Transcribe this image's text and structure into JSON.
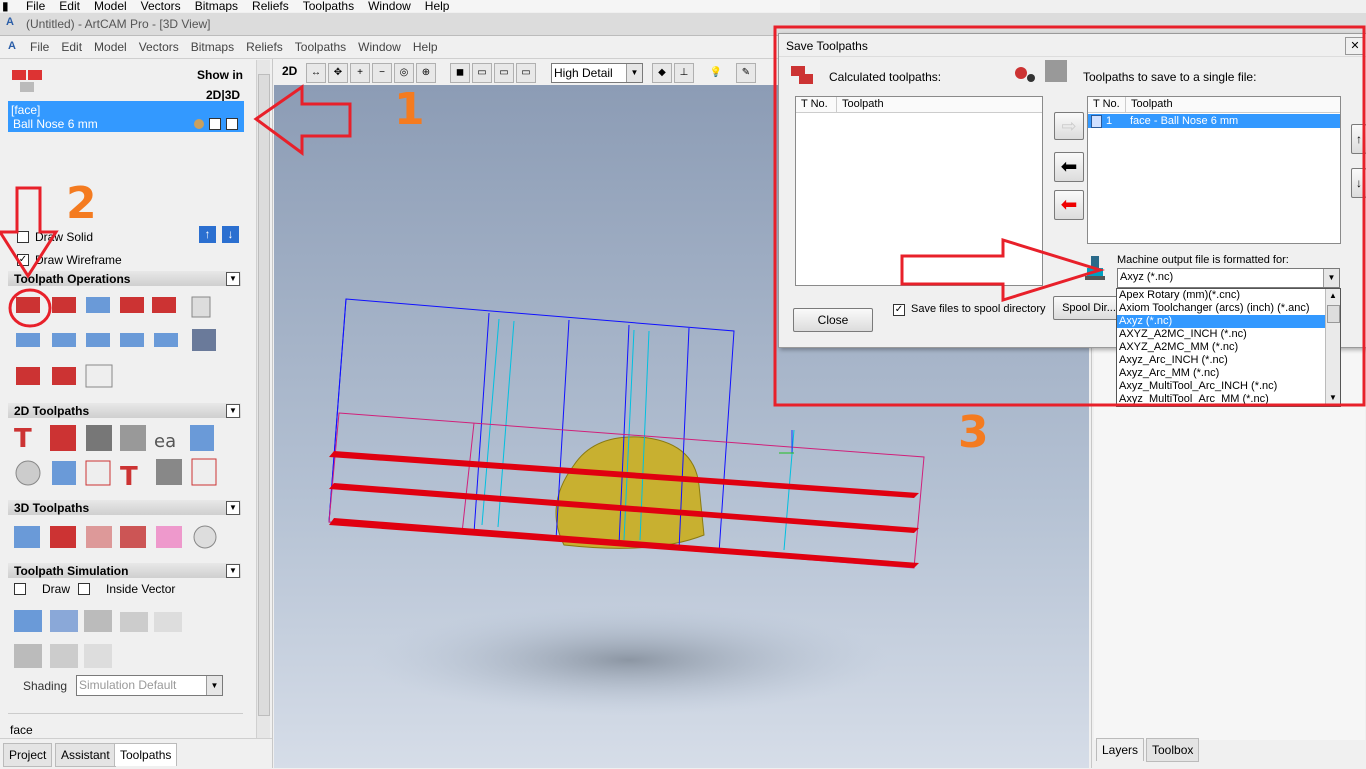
{
  "top_menu": [
    "File",
    "Edit",
    "Model",
    "Vectors",
    "Bitmaps",
    "Reliefs",
    "Toolpaths",
    "Window",
    "Help"
  ],
  "window_title": "(Untitled) - ArtCAM Pro - [3D View]",
  "app_menu": [
    "File",
    "Edit",
    "Model",
    "Vectors",
    "Bitmaps",
    "Reliefs",
    "Toolpaths",
    "Window",
    "Help"
  ],
  "left_panel": {
    "show_in_label": "Show in",
    "show_in_modes": "2D|3D",
    "toolpath_group": "[face]",
    "toolpath_name": "Ball Nose 6 mm",
    "draw_solid": "Draw Solid",
    "draw_wireframe": "Draw Wireframe",
    "sec_operations": "Toolpath Operations",
    "sec_2d": "2D Toolpaths",
    "sec_3d": "3D Toolpaths",
    "sec_sim": "Toolpath Simulation",
    "sim_draw": "Draw",
    "sim_inside_vector": "Inside Vector",
    "shading_label": "Shading",
    "shading_value": "Simulation Default",
    "bottom_label": "face"
  },
  "left_tabs": [
    "Project",
    "Assistant",
    "Toolpaths"
  ],
  "viewport_toolbar": {
    "mode_2d": "2D",
    "detail": "High Detail"
  },
  "right_tabs": [
    "Layers",
    "Toolbox"
  ],
  "dialog": {
    "title": "Save Toolpaths",
    "calculated_label": "Calculated toolpaths:",
    "save_single_label": "Toolpaths to save to a single file:",
    "col_tno": "T No.",
    "col_toolpath": "Toolpath",
    "saved_row_no": "1",
    "saved_row_name": "face - Ball Nose 6 mm",
    "machine_label": "Machine output file is formatted for:",
    "machine_selected": "Axyz (*.nc)",
    "close_btn": "Close",
    "spool_checkbox": "Save files to spool directory",
    "spool_btn": "Spool Dir...",
    "post_options": [
      "Apex Rotary (mm)(*.cnc)",
      "Axiom Toolchanger (arcs) (inch) (*.anc)",
      "Axyz (*.nc)",
      "AXYZ_A2MC_INCH (*.nc)",
      "AXYZ_A2MC_MM (*.nc)",
      "Axyz_Arc_INCH (*.nc)",
      "Axyz_Arc_MM (*.nc)",
      "Axyz_MultiTool_Arc_INCH (*.nc)",
      "Axyz_MultiTool_Arc_MM (*.nc)"
    ]
  },
  "annotations": [
    "1",
    "2",
    "3"
  ],
  "colors": {
    "annotation_red": "#e8202a",
    "annotation_orange": "#f47b20",
    "selection": "#3399ff"
  }
}
